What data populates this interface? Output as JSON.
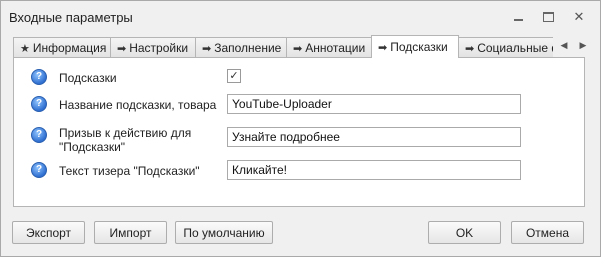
{
  "window": {
    "title": "Входные параметры",
    "controls": {
      "minimize": "—",
      "close": "✕"
    }
  },
  "tabs": [
    {
      "icon": "star-icon",
      "glyph": "★",
      "label": "Информация",
      "active": false
    },
    {
      "icon": "arrow-right-icon",
      "glyph": "➡",
      "label": "Настройки",
      "active": false
    },
    {
      "icon": "arrow-right-icon",
      "glyph": "➡",
      "label": "Заполнение",
      "active": false
    },
    {
      "icon": "arrow-right-icon",
      "glyph": "➡",
      "label": "Аннотации",
      "active": false
    },
    {
      "icon": "arrow-right-icon",
      "glyph": "➡",
      "label": "Подсказки",
      "active": true
    },
    {
      "icon": "arrow-right-icon",
      "glyph": "➡",
      "label": "Социальные ф",
      "active": false
    }
  ],
  "tab_scroll": {
    "left": "◀",
    "right": "▶"
  },
  "form": {
    "hints": {
      "help": "?",
      "label": "Подсказки",
      "checked": true,
      "check_glyph": "✓"
    },
    "title": {
      "help": "?",
      "label": "Название подсказки, товара",
      "value": "YouTube-Uploader"
    },
    "cta": {
      "help": "?",
      "label_line1": "Призыв к действию для",
      "label_line2": "\"Подсказки\"",
      "value": "Узнайте подробнее"
    },
    "teaser": {
      "help": "?",
      "label": "Текст тизера \"Подсказки\"",
      "value": "Кликайте!"
    }
  },
  "buttons": {
    "export": "Экспорт",
    "import": "Импорт",
    "default": "По умолчанию",
    "ok": "OK",
    "cancel": "Отмена"
  },
  "colors": {
    "help_icon": "#2f6fd0",
    "window_bg": "#f0f0f0",
    "panel_bg": "#ffffff"
  }
}
